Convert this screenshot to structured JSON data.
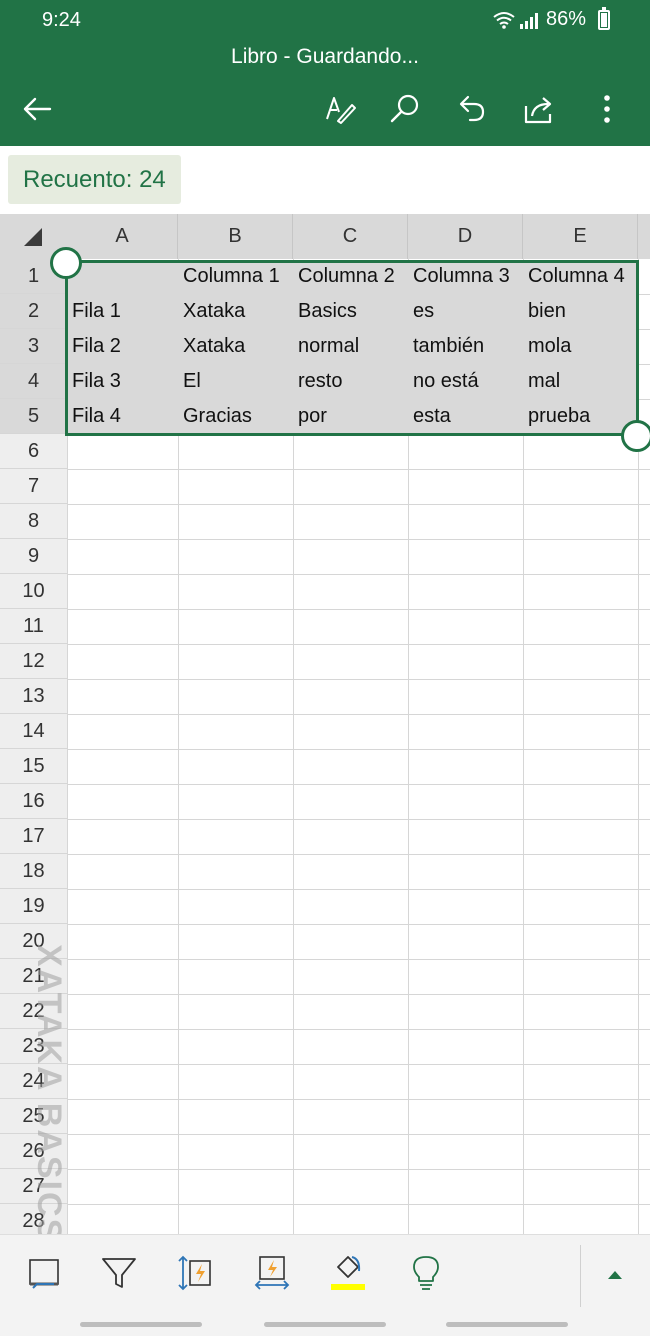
{
  "status_bar": {
    "time": "9:24",
    "battery": "86%"
  },
  "title_bar": {
    "document_title": "Libro - Guardando..."
  },
  "toolbar": {
    "icons": [
      "back-arrow-icon",
      "pen-edit-icon",
      "search-icon",
      "undo-icon",
      "share-icon",
      "more-vert-icon"
    ]
  },
  "status_count": {
    "label": "Recuento: 24"
  },
  "sheet": {
    "columns": [
      "A",
      "B",
      "C",
      "D",
      "E"
    ],
    "rows": [
      "1",
      "2",
      "3",
      "4",
      "5",
      "6",
      "7",
      "8",
      "9",
      "10",
      "11",
      "12",
      "13",
      "14",
      "15",
      "16",
      "17",
      "18",
      "19",
      "20",
      "21",
      "22",
      "23",
      "24",
      "25",
      "26",
      "27",
      "28"
    ],
    "cells": [
      [
        "",
        "Columna 1",
        "Columna 2",
        "Columna 3",
        "Columna 4"
      ],
      [
        "Fila 1",
        "Xataka",
        "Basics",
        "es",
        "bien"
      ],
      [
        "Fila 2",
        "Xataka",
        "normal",
        "también",
        "mola"
      ],
      [
        "Fila 3",
        "El",
        "resto",
        "no está",
        "mal"
      ],
      [
        "Fila 4",
        "Gracias",
        "por",
        "esta",
        "prueba"
      ]
    ],
    "selection": "A1:E5",
    "accent_color": "#217346",
    "watermark": "XATAKA BASICS"
  },
  "bottom_toolbar": {
    "tools": [
      "borders-icon",
      "filter-icon",
      "autofit-rows-icon",
      "autofit-columns-icon",
      "fill-color-icon",
      "lightbulb-icon"
    ],
    "fill_color": "#ffff00",
    "collapse_icon": "expand-up-icon"
  }
}
